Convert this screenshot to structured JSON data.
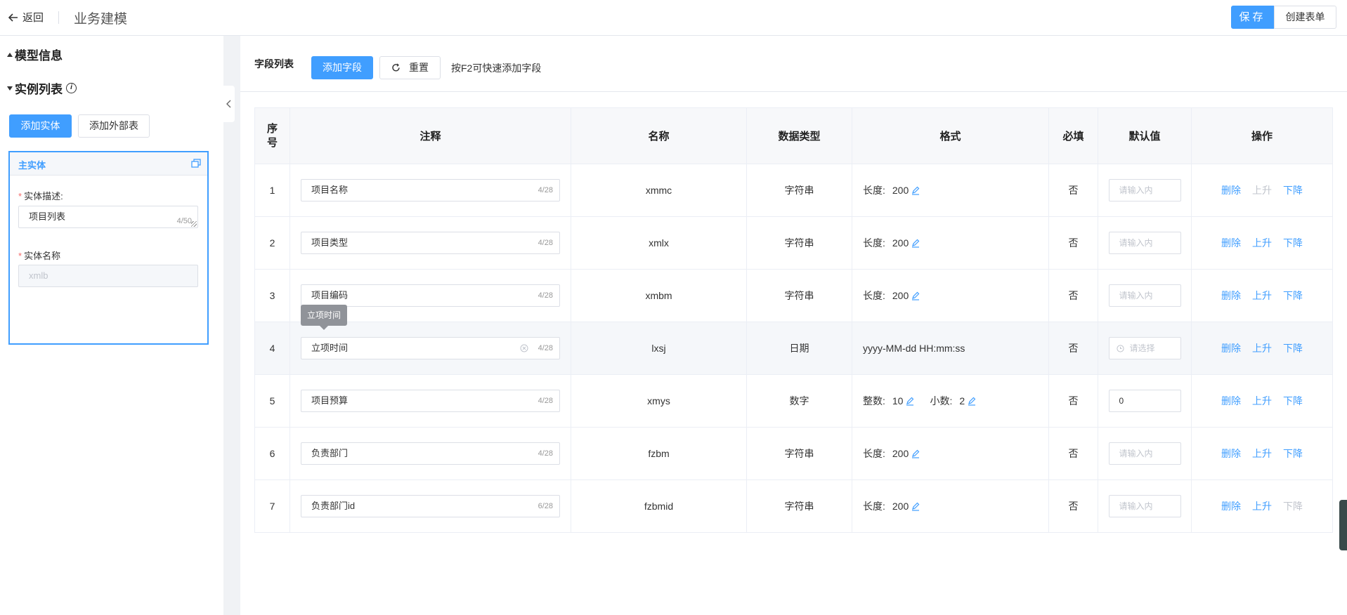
{
  "header": {
    "back_label": "返回",
    "title": "业务建模",
    "save_label": "保存",
    "create_form_label": "创建表单"
  },
  "sidebar": {
    "model_info_label": "模型信息",
    "instance_list_label": "实例列表",
    "add_entity_label": "添加实体",
    "add_external_label": "添加外部表",
    "entity": {
      "title": "主实体",
      "desc_label": "实体描述:",
      "desc_value": "项目列表",
      "desc_count": "4/50",
      "name_label": "实体名称",
      "name_value": "xmlb"
    }
  },
  "fields": {
    "title": "字段列表",
    "add_label": "添加字段",
    "reset_label": "重置",
    "hint": "按F2可快速添加字段",
    "tooltip": "立项时间",
    "columns": [
      "序号",
      "注释",
      "名称",
      "数据类型",
      "格式",
      "必填",
      "默认值",
      "操作"
    ],
    "placeholder_input": "请输入内",
    "placeholder_select": "请选择",
    "ops": {
      "delete": "删除",
      "up": "上升",
      "down": "下降"
    },
    "rows": [
      {
        "no": "1",
        "comment": "项目名称",
        "count": "4/28",
        "name": "xmmc",
        "type": "字符串",
        "fmt_label": "长度:",
        "fmt_value": "200",
        "required": "否",
        "default": "",
        "up_enabled": false,
        "down_enabled": true
      },
      {
        "no": "2",
        "comment": "项目类型",
        "count": "4/28",
        "name": "xmlx",
        "type": "字符串",
        "fmt_label": "长度:",
        "fmt_value": "200",
        "required": "否",
        "default": "",
        "up_enabled": true,
        "down_enabled": true
      },
      {
        "no": "3",
        "comment": "项目编码",
        "count": "4/28",
        "name": "xmbm",
        "type": "字符串",
        "fmt_label": "长度:",
        "fmt_value": "200",
        "required": "否",
        "default": "",
        "up_enabled": true,
        "down_enabled": true
      },
      {
        "no": "4",
        "comment": "立项时间",
        "count": "4/28",
        "name": "lxsj",
        "type": "日期",
        "fmt_text": "yyyy-MM-dd HH:mm:ss",
        "required": "否",
        "default": "",
        "up_enabled": true,
        "down_enabled": true
      },
      {
        "no": "5",
        "comment": "项目预算",
        "count": "4/28",
        "name": "xmys",
        "type": "数字",
        "fmt_int_label": "整数:",
        "fmt_int_value": "10",
        "fmt_dec_label": "小数:",
        "fmt_dec_value": "2",
        "required": "否",
        "default": "0",
        "up_enabled": true,
        "down_enabled": true
      },
      {
        "no": "6",
        "comment": "负责部门",
        "count": "4/28",
        "name": "fzbm",
        "type": "字符串",
        "fmt_label": "长度:",
        "fmt_value": "200",
        "required": "否",
        "default": "",
        "up_enabled": true,
        "down_enabled": true
      },
      {
        "no": "7",
        "comment": "负责部门id",
        "count": "6/28",
        "name": "fzbmid",
        "type": "字符串",
        "fmt_label": "长度:",
        "fmt_value": "200",
        "required": "否",
        "default": "",
        "up_enabled": true,
        "down_enabled": false
      }
    ]
  },
  "colors": {
    "primary": "#409eff",
    "disabled": "#c0c4cc",
    "border": "#dcdfe6",
    "required": "#f56c6c"
  }
}
